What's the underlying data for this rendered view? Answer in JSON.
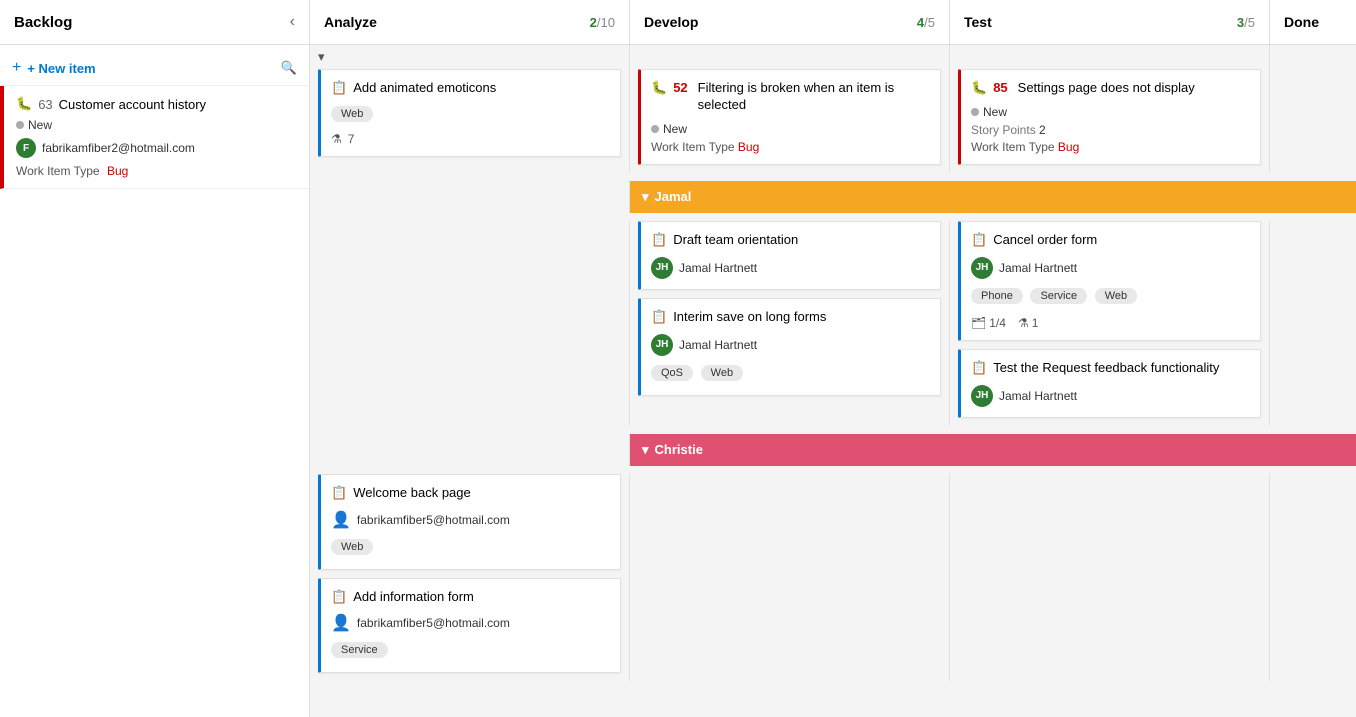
{
  "columns": {
    "backlog": {
      "label": "Backlog",
      "chevron": "‹"
    },
    "analyze": {
      "label": "Analyze",
      "count_done": "2",
      "count_total": "10"
    },
    "develop": {
      "label": "Develop",
      "count_done": "4",
      "count_total": "5"
    },
    "test": {
      "label": "Test",
      "count_done": "3",
      "count_total": "5"
    },
    "done": {
      "label": "Done"
    }
  },
  "sidebar": {
    "new_item_label": "+ New item",
    "search_icon": "🔍",
    "item": {
      "id": "63",
      "title": "Customer account history",
      "status": "New",
      "email": "fabrikamfiber2@hotmail.com",
      "avatar_initials": "F",
      "work_item_type_label": "Work Item Type",
      "work_item_type_value": "Bug"
    }
  },
  "collapse_button": "▾",
  "unassigned_section": {
    "cards_analyze": [
      {
        "id": null,
        "icon": "📋",
        "title": "Add animated emoticons",
        "tags": [
          "Web"
        ],
        "flask_count": "7",
        "border": "blue"
      }
    ],
    "cards_develop": [
      {
        "id": "52",
        "icon": "🐛",
        "title": "Filtering is broken when an item is selected",
        "status": "New",
        "work_item_type_label": "Work Item Type",
        "work_item_type_value": "Bug",
        "border": "red"
      }
    ],
    "cards_test": [
      {
        "id": "85",
        "icon": "🐛",
        "title": "Settings page does not display",
        "status": "New",
        "story_points_label": "Story Points",
        "story_points_value": "2",
        "work_item_type_label": "Work Item Type",
        "work_item_type_value": "Bug",
        "border": "red"
      }
    ]
  },
  "jamal_section": {
    "label": "Jamal",
    "chevron": "▾",
    "cards_develop": [
      {
        "icon": "📋",
        "title": "Draft team orientation",
        "avatar_initials": "JH",
        "user": "Jamal Hartnett",
        "border": "blue"
      },
      {
        "icon": "📋",
        "title": "Interim save on long forms",
        "avatar_initials": "JH",
        "user": "Jamal Hartnett",
        "tags": [
          "QoS",
          "Web"
        ],
        "border": "blue"
      }
    ],
    "cards_test": [
      {
        "icon": "📋",
        "title": "Cancel order form",
        "avatar_initials": "JH",
        "user": "Jamal Hartnett",
        "tags": [
          "Phone",
          "Service",
          "Web"
        ],
        "fraction": "1/4",
        "flask_count": "1",
        "border": "blue"
      },
      {
        "icon": "📋",
        "title": "Test the Request feedback functionality",
        "avatar_initials": "JH",
        "user": "Jamal Hartnett",
        "border": "blue"
      }
    ]
  },
  "christie_section": {
    "label": "Christie",
    "chevron": "▾",
    "cards_analyze": [
      {
        "icon": "📋",
        "title": "Welcome back page",
        "user": "fabrikamfiber5@hotmail.com",
        "avatar_icon": "👤",
        "tags": [
          "Web"
        ],
        "border": "blue"
      },
      {
        "icon": "📋",
        "title": "Add information form",
        "user": "fabrikamfiber5@hotmail.com",
        "avatar_icon": "👤",
        "tags": [
          "Service"
        ],
        "border": "blue"
      }
    ]
  }
}
